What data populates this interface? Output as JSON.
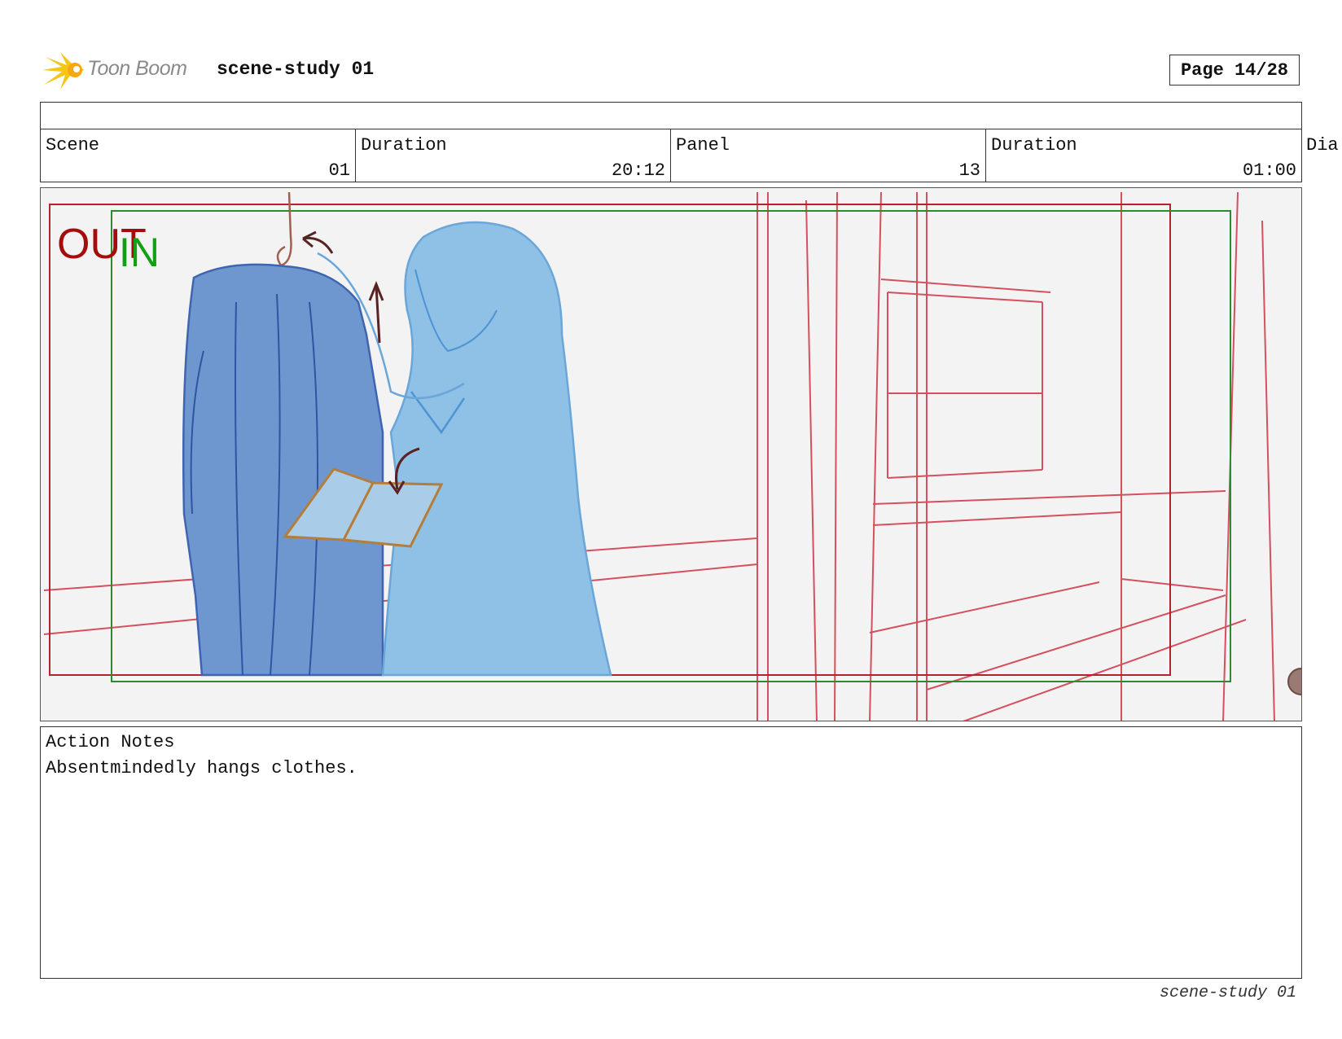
{
  "header": {
    "logo_text": "Toon Boom",
    "title": "scene-study 01",
    "page": "Page 14/28"
  },
  "info": {
    "scene_label": "Scene",
    "scene_value": "01",
    "duration_label": "Duration",
    "duration_value": "20:12",
    "panel_label": "Panel",
    "panel_value": "13",
    "panel_duration_label": "Duration",
    "panel_duration_value": "01:00",
    "dialog_label": "Dia"
  },
  "panel": {
    "out_label": "OUT",
    "in_label": "IN",
    "colors": {
      "out": "#a50d0d",
      "in": "#12a012",
      "layout_lines": "#d4505e",
      "character": "#8fc0e6",
      "coat": "#6f97cf",
      "book": "#b57d3a"
    }
  },
  "notes": {
    "label": "Action Notes",
    "text": "Absentmindedly hangs clothes."
  },
  "footer": {
    "text": "scene-study 01"
  }
}
